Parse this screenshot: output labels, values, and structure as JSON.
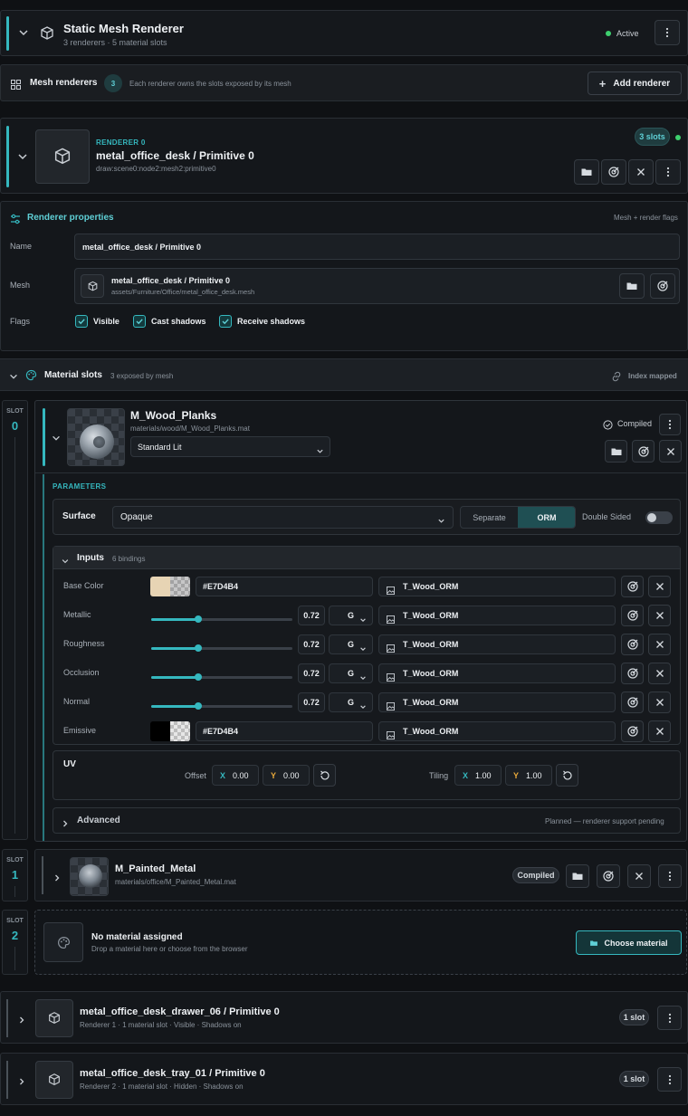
{
  "header": {
    "title": "Static Mesh Renderer",
    "subtitle": "3 renderers · 5 material slots",
    "status": "Active"
  },
  "toolbar": {
    "label": "Mesh renderers",
    "count": "3",
    "hint": "Each renderer owns the slots exposed by its mesh",
    "add_label": "Add renderer"
  },
  "renderer0": {
    "kicker": "RENDERER 0",
    "title": "metal_office_desk / Primitive 0",
    "path": "draw:scene0:node2:mesh2:primitive0",
    "slots_badge": "3 slots"
  },
  "props": {
    "title": "Renderer properties",
    "hint": "Mesh + render flags",
    "name_label": "Name",
    "name_value": "metal_office_desk / Primitive 0",
    "mesh_label": "Mesh",
    "mesh_name": "metal_office_desk / Primitive 0",
    "mesh_path": "assets/Furniture/Office/metal_office_desk.mesh",
    "flags_label": "Flags",
    "flags": [
      "Visible",
      "Cast shadows",
      "Receive shadows"
    ]
  },
  "slots_section": {
    "title": "Material slots",
    "hint": "3 exposed by mesh",
    "mapping": "Index mapped"
  },
  "slot0": {
    "slot_word": "SLOT",
    "index": "0",
    "name": "M_Wood_Planks",
    "path": "materials/wood/M_Wood_Planks.mat",
    "shader": "Standard Lit",
    "status": "Compiled",
    "params_title": "PARAMETERS",
    "surface_label": "Surface",
    "surface_value": "Opaque",
    "seg_separate": "Separate",
    "seg_orm": "ORM",
    "double_sided": "Double Sided",
    "inputs_title": "Inputs",
    "inputs_count": "6 bindings",
    "inputs": [
      {
        "label": "Base Color",
        "hex": "#E7D4B4",
        "texture": "T_Wood_ORM",
        "swatch": "#E7D4B4"
      },
      {
        "label": "Metallic",
        "value": "0.72",
        "channel": "G",
        "texture": "T_Wood_ORM"
      },
      {
        "label": "Roughness",
        "value": "0.72",
        "channel": "G",
        "texture": "T_Wood_ORM"
      },
      {
        "label": "Occlusion",
        "value": "0.72",
        "channel": "G",
        "texture": "T_Wood_ORM"
      },
      {
        "label": "Normal",
        "value": "0.72",
        "channel": "G",
        "texture": "T_Wood_ORM"
      },
      {
        "label": "Emissive",
        "hex": "#E7D4B4",
        "texture": "T_Wood_ORM",
        "swatch": "#000000"
      }
    ],
    "uv_title": "UV",
    "offset_label": "Offset",
    "offset_x": "0.00",
    "offset_y": "0.00",
    "tiling_label": "Tiling",
    "tiling_x": "1.00",
    "tiling_y": "1.00",
    "x": "X",
    "y": "Y",
    "advanced_title": "Advanced",
    "advanced_note": "Planned — renderer support pending"
  },
  "slot1": {
    "slot_word": "SLOT",
    "index": "1",
    "name": "M_Painted_Metal",
    "path": "materials/office/M_Painted_Metal.mat",
    "status": "Compiled"
  },
  "slot2": {
    "slot_word": "SLOT",
    "index": "2",
    "title": "No material assigned",
    "hint": "Drop a material here or choose from the browser",
    "button": "Choose material"
  },
  "renderer1": {
    "title": "metal_office_desk_drawer_06 / Primitive 0",
    "meta": "Renderer 1 · 1 material slot · Visible · Shadows on",
    "badge": "1 slot"
  },
  "renderer2": {
    "title": "metal_office_desk_tray_01 / Primitive 0",
    "meta": "Renderer 2 · 1 material slot · Hidden · Shadows on",
    "badge": "1 slot"
  },
  "colors": {
    "accent": "#35b8bf",
    "active": "#3ecf6e",
    "background": "#0f1114"
  }
}
